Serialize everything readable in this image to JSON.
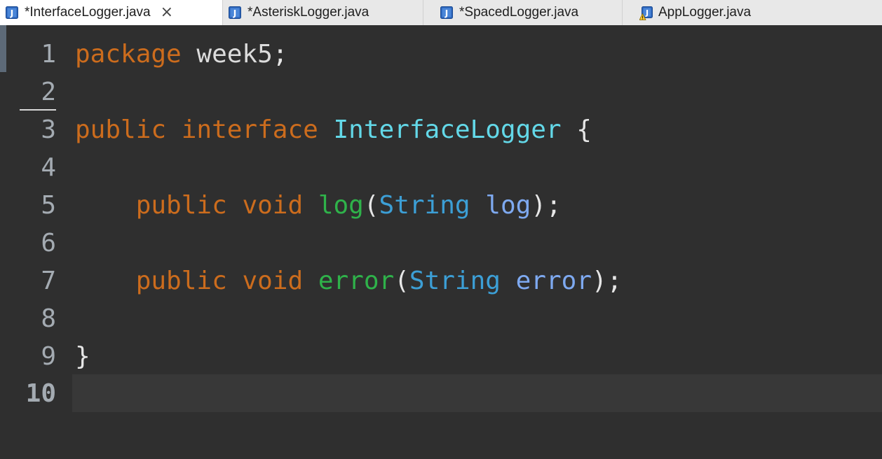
{
  "tabs": [
    {
      "label": "*InterfaceLogger.java",
      "active": true,
      "close": "×",
      "icon": "java-file-icon"
    },
    {
      "label": "*AsteriskLogger.java",
      "active": false,
      "icon": "java-file-icon"
    },
    {
      "label": "*SpacedLogger.java",
      "active": false,
      "icon": "java-file-icon"
    },
    {
      "label": "AppLogger.java",
      "active": false,
      "icon": "java-file-warning-icon"
    }
  ],
  "editor": {
    "line_numbers": [
      "1",
      "2",
      "3",
      "4",
      "5",
      "6",
      "7",
      "8",
      "9",
      "10"
    ],
    "lines": {
      "l1": {
        "kw": "package",
        "name": "week5",
        "semi": ";"
      },
      "l3": {
        "kw1": "public",
        "kw2": "interface",
        "name": "InterfaceLogger",
        "brace": "{"
      },
      "l5": {
        "kw1": "public",
        "kw2": "void",
        "method": "log",
        "open": "(",
        "type": "String",
        "param": "log",
        "close": ");"
      },
      "l7": {
        "kw1": "public",
        "kw2": "void",
        "method": "error",
        "open": "(",
        "type": "String",
        "param": "error",
        "close": ");"
      },
      "l9": {
        "brace": "}"
      }
    },
    "colors": {
      "background": "#2f2f2f",
      "keyword": "#cc6c1d",
      "class_name": "#63d8e8",
      "method": "#2fb24a",
      "type": "#3c9fd6",
      "parameter": "#7ea9f0"
    }
  }
}
